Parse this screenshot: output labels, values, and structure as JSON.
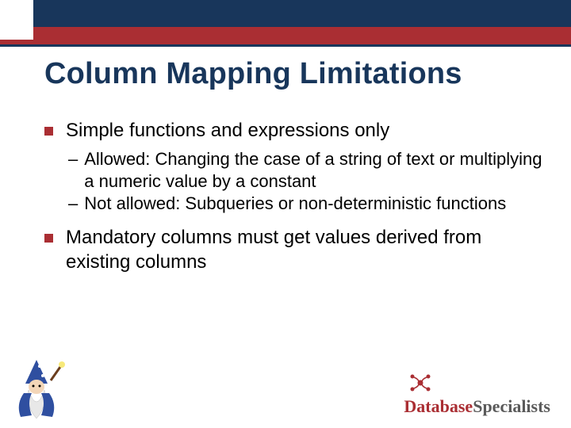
{
  "title": "Column Mapping Limitations",
  "bullets": [
    {
      "text": "Simple functions and expressions only",
      "subs": [
        "Allowed: Changing the case of a string of text or multiplying a numeric value by a constant",
        "Not allowed: Subqueries or non-deterministic functions"
      ]
    },
    {
      "text": "Mandatory columns must get values derived from existing columns",
      "subs": []
    }
  ],
  "logo": {
    "part1": "Database",
    "part2": "Specialists"
  }
}
